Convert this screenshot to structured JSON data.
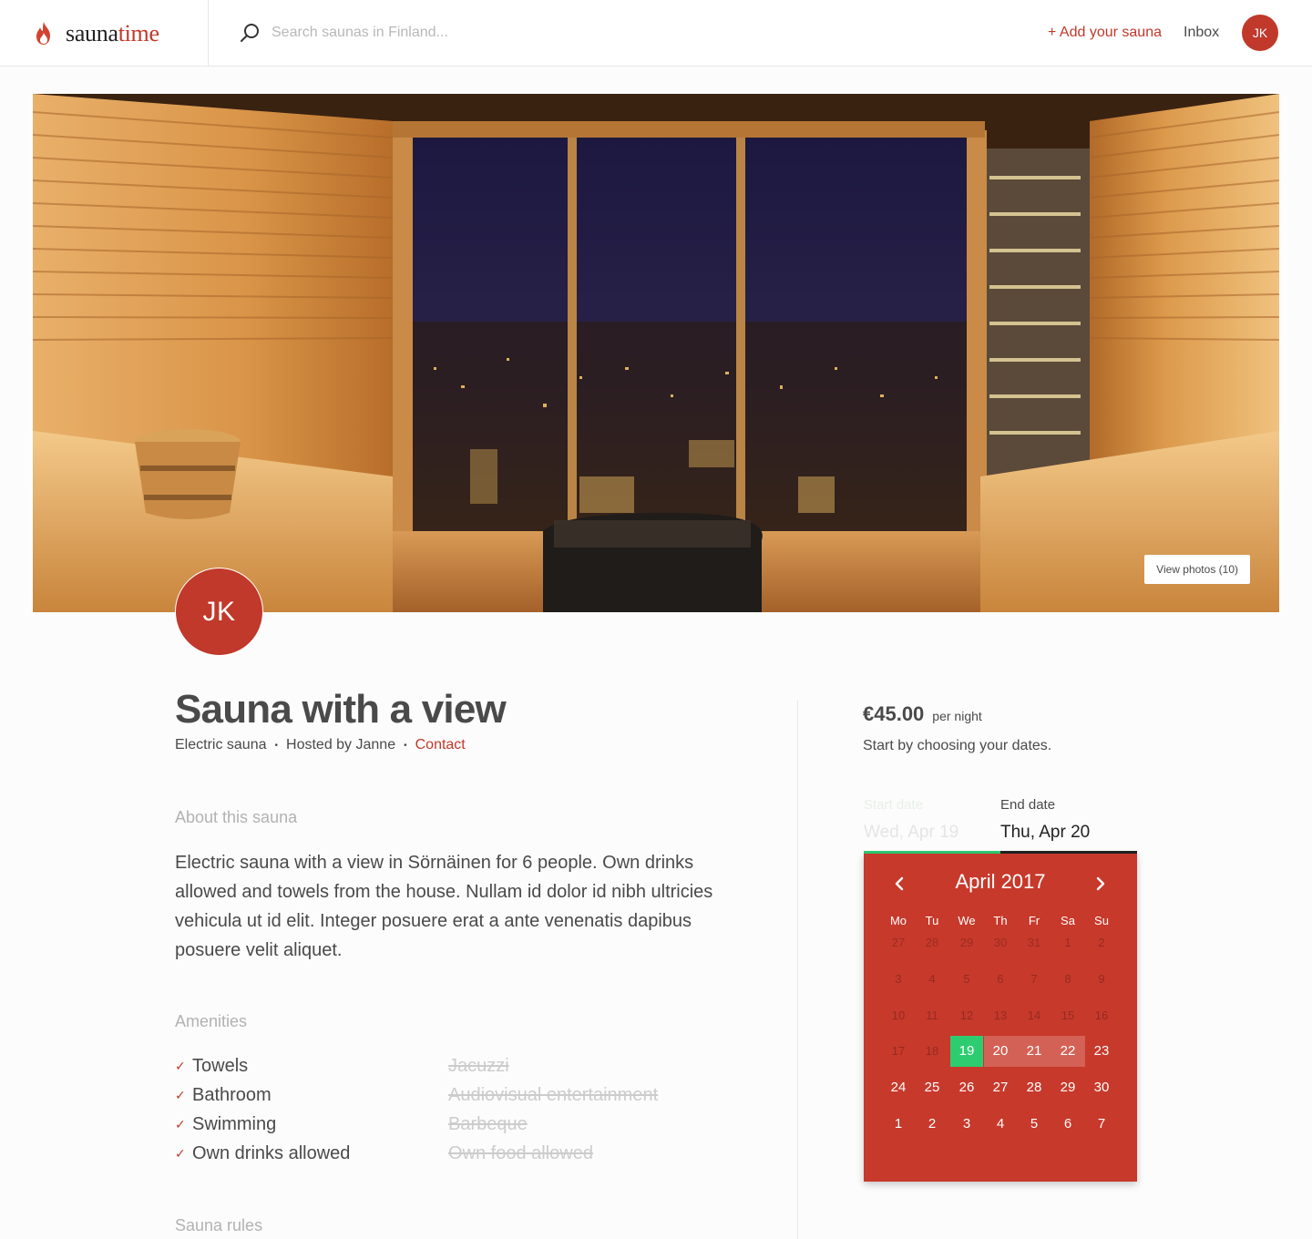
{
  "brand": {
    "name_part1": "sauna",
    "name_part2": "time"
  },
  "search": {
    "placeholder": "Search saunas in Finland..."
  },
  "nav": {
    "add_label": "+ Add your sauna",
    "inbox_label": "Inbox",
    "avatar_initials": "JK"
  },
  "hero": {
    "view_photos_label": "View photos (10)"
  },
  "host": {
    "initials": "JK"
  },
  "listing": {
    "title": "Sauna with a view",
    "type": "Electric sauna",
    "hosted_by": "Hosted by Janne",
    "contact_label": "Contact"
  },
  "about": {
    "heading": "About this sauna",
    "text": "Electric sauna with a view in Sörnäinen for 6 people. Own drinks allowed and towels from the house. Nullam id dolor id nibh ultricies vehicula ut id elit. Integer posuere erat a ante venenatis dapibus posuere velit aliquet."
  },
  "amenities": {
    "heading": "Amenities",
    "included": [
      "Towels",
      "Bathroom",
      "Swimming",
      "Own drinks allowed"
    ],
    "excluded": [
      "Jacuzzi",
      "Audiovisual entertainment",
      "Barbeque",
      "Own food allowed"
    ]
  },
  "rules": {
    "heading": "Sauna rules"
  },
  "booking": {
    "price": "€45.00",
    "price_unit": "per night",
    "hint": "Start by choosing your dates.",
    "start_label": "Start date",
    "start_value": "Wed, Apr 19",
    "end_label": "End date",
    "end_value": "Thu, Apr 20"
  },
  "calendar": {
    "month_label": "April 2017",
    "weekdays": [
      "Mo",
      "Tu",
      "We",
      "Th",
      "Fr",
      "Sa",
      "Su"
    ],
    "weeks": [
      [
        {
          "d": "27",
          "s": "out"
        },
        {
          "d": "28",
          "s": "out"
        },
        {
          "d": "29",
          "s": "out"
        },
        {
          "d": "30",
          "s": "out"
        },
        {
          "d": "31",
          "s": "out"
        },
        {
          "d": "1",
          "s": "dis"
        },
        {
          "d": "2",
          "s": "dis"
        }
      ],
      [
        {
          "d": "3",
          "s": "dis"
        },
        {
          "d": "4",
          "s": "dis"
        },
        {
          "d": "5",
          "s": "dis"
        },
        {
          "d": "6",
          "s": "dis"
        },
        {
          "d": "7",
          "s": "dis"
        },
        {
          "d": "8",
          "s": "dis"
        },
        {
          "d": "9",
          "s": "dis"
        }
      ],
      [
        {
          "d": "10",
          "s": "dis"
        },
        {
          "d": "11",
          "s": "dis"
        },
        {
          "d": "12",
          "s": "dis"
        },
        {
          "d": "13",
          "s": "dis"
        },
        {
          "d": "14",
          "s": "dis"
        },
        {
          "d": "15",
          "s": "dis"
        },
        {
          "d": "16",
          "s": "dis"
        }
      ],
      [
        {
          "d": "17",
          "s": "dis"
        },
        {
          "d": "18",
          "s": "dis"
        },
        {
          "d": "19",
          "s": "sel"
        },
        {
          "d": "20",
          "s": "range"
        },
        {
          "d": "21",
          "s": "range"
        },
        {
          "d": "22",
          "s": "range"
        },
        {
          "d": "23",
          "s": "on"
        }
      ],
      [
        {
          "d": "24",
          "s": "on"
        },
        {
          "d": "25",
          "s": "on"
        },
        {
          "d": "26",
          "s": "on"
        },
        {
          "d": "27",
          "s": "on"
        },
        {
          "d": "28",
          "s": "on"
        },
        {
          "d": "29",
          "s": "on"
        },
        {
          "d": "30",
          "s": "on"
        }
      ],
      [
        {
          "d": "1",
          "s": "on"
        },
        {
          "d": "2",
          "s": "on"
        },
        {
          "d": "3",
          "s": "on"
        },
        {
          "d": "4",
          "s": "on"
        },
        {
          "d": "5",
          "s": "on"
        },
        {
          "d": "6",
          "s": "on"
        },
        {
          "d": "7",
          "s": "on"
        }
      ]
    ]
  },
  "colors": {
    "brand_red": "#c0392b",
    "selected_green": "#2ecc71",
    "text": "#4a4a4a"
  },
  "icons": {
    "logo": "flame-icon",
    "search": "search-icon",
    "prev": "chevron-left-icon",
    "next": "chevron-right-icon",
    "check": "check-icon"
  }
}
